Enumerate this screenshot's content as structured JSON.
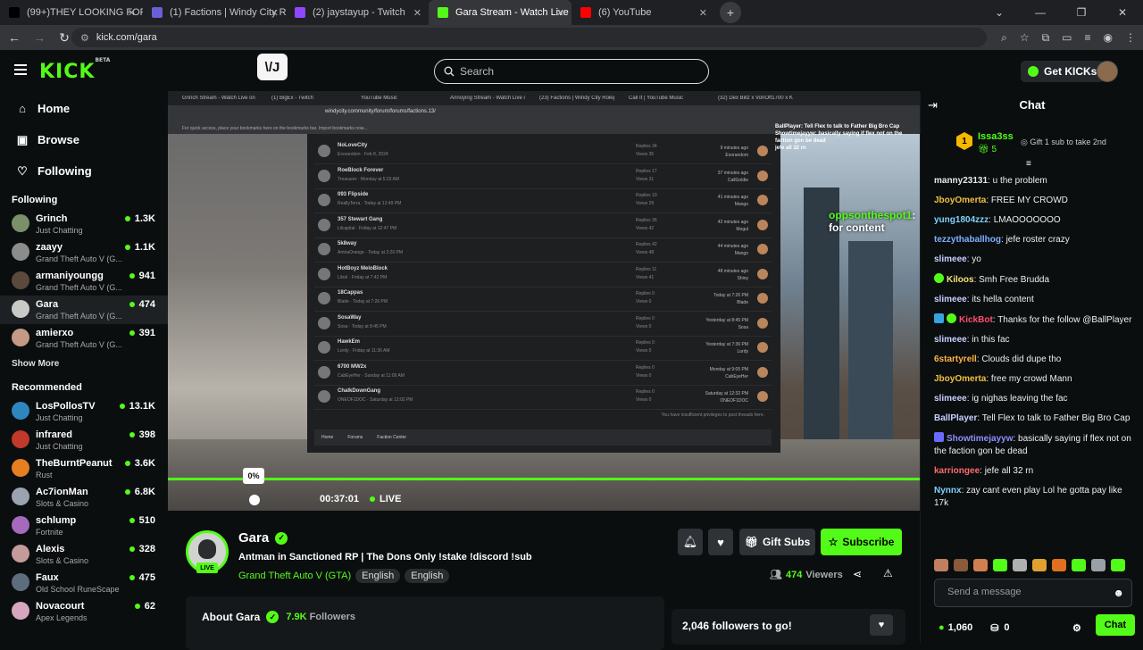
{
  "browser": {
    "tabs": [
      {
        "title": "(99+)THEY LOOKING FOR THEIR",
        "color": "#000000"
      },
      {
        "title": "(1) Factions | Windy City Rolepla",
        "color": "#6b5fd8"
      },
      {
        "title": "(2) jaystayup - Twitch",
        "color": "#9146ff"
      },
      {
        "title": "Gara Stream - Watch Live on Ki",
        "color": "#53fc18",
        "active": true
      },
      {
        "title": "(6) YouTube",
        "color": "#ff0000"
      }
    ],
    "url": "kick.com/gara"
  },
  "header": {
    "logo": "KICK",
    "logo_sup": "BETA",
    "ext_label": "\\/J",
    "search_placeholder": "Search",
    "get_kicks": "Get KICKs"
  },
  "sidebar": {
    "nav": [
      {
        "label": "Home",
        "icon": "home-icon"
      },
      {
        "label": "Browse",
        "icon": "browse-icon"
      },
      {
        "label": "Following",
        "icon": "heart-icon"
      }
    ],
    "following_title": "Following",
    "following": [
      {
        "name": "Grinch",
        "category": "Just Chatting",
        "viewers": "1.3K",
        "color": "#7a8f6a"
      },
      {
        "name": "zaayy",
        "category": "Grand Theft Auto V (G...",
        "viewers": "1.1K",
        "color": "#8c8c8c"
      },
      {
        "name": "armaniyoungg",
        "category": "Grand Theft Auto V (G...",
        "viewers": "941",
        "color": "#5b4a3b"
      },
      {
        "name": "Gara",
        "category": "Grand Theft Auto V (G...",
        "viewers": "474",
        "color": "#c8cac8"
      },
      {
        "name": "amierxo",
        "category": "Grand Theft Auto V (G...",
        "viewers": "391",
        "color": "#c49a86"
      }
    ],
    "show_more": "Show More",
    "recommended_title": "Recommended",
    "recommended": [
      {
        "name": "LosPollosTV",
        "category": "Just Chatting",
        "viewers": "13.1K",
        "color": "#2e86c1"
      },
      {
        "name": "infrared",
        "category": "Just Chatting",
        "viewers": "398",
        "color": "#c0392b"
      },
      {
        "name": "TheBurntPeanut",
        "category": "Rust",
        "viewers": "3.6K",
        "color": "#e67e22"
      },
      {
        "name": "Ac7ionMan",
        "category": "Slots & Casino",
        "viewers": "6.8K",
        "color": "#9aa3b0"
      },
      {
        "name": "schlump",
        "category": "Fortnite",
        "viewers": "510",
        "color": "#a569bd"
      },
      {
        "name": "Alexis",
        "category": "Slots & Casino",
        "viewers": "328",
        "color": "#c39b9b"
      },
      {
        "name": "Faux",
        "category": "Old School RuneScape",
        "viewers": "475",
        "color": "#5d6d7e"
      },
      {
        "name": "Novacourt",
        "category": "Apex Legends",
        "viewers": "62",
        "color": "#d5a6bd"
      }
    ]
  },
  "video": {
    "inner_url": "windycity.community/forum/forums/factions.13/",
    "inner_tabs": [
      "Grinch Stream - Watch Live on Kick",
      "(1) BigEx - Twitch",
      "YouTube Music",
      "Annoying Stream - Watch Live on Kick",
      "(23) Factions | Windy City Rolep",
      "Call It | YouTube Music",
      "(32) Dex Billz x VonOff1700 x Kyle R"
    ],
    "bookmarks_hint": "For quick access, place your bookmarks here on the bookmarks bar. Import bookmarks now...",
    "forum_rows": [
      {
        "title": "NoLoveCity",
        "sub": "Exorandom · Feb 8, 2024",
        "replies": "34",
        "views": "35",
        "date": "9 minutes ago",
        "user": "Exorandom"
      },
      {
        "title": "RoeBlock Forever",
        "sub": "Treasurer · Monday at 5:23 AM",
        "replies": "17",
        "views": "31",
        "date": "37 minutes ago",
        "user": "CallGoldie"
      },
      {
        "title": "093 Flipside",
        "sub": "ReallyTerra · Today at 12:49 PM",
        "replies": "19",
        "views": "29",
        "date": "41 minutes ago",
        "user": "Mango"
      },
      {
        "title": "357 Stewart Gang",
        "sub": "Lilcapital · Friday at 12:47 PM",
        "replies": "36",
        "views": "42",
        "date": "42 minutes ago",
        "user": "Mogul"
      },
      {
        "title": "5k8way",
        "sub": "AmiraOrange · Today at 2:26 PM",
        "replies": "42",
        "views": "48",
        "date": "44 minutes ago",
        "user": "Mango"
      },
      {
        "title": "HotBoyz MeloBlock",
        "sub": "Lilsol · Friday at 7:42 PM",
        "replies": "11",
        "views": "41",
        "date": "48 minutes ago",
        "user": "Shiny"
      },
      {
        "title": "18Cappas",
        "sub": "Blade · Today at 7:26 PM",
        "replies": "0",
        "views": "0",
        "date": "Today at 7:26 PM",
        "user": "Blade"
      },
      {
        "title": "SosaWay",
        "sub": "Sosa · Today at 8:45 PM",
        "replies": "0",
        "views": "0",
        "date": "Yesterday at 8:45 PM",
        "user": "Sosa"
      },
      {
        "title": "HawkEm",
        "sub": "Lordy · Friday at 11:36 AM",
        "replies": "0",
        "views": "0",
        "date": "Yesterday at 7:36 PM",
        "user": "Lordy"
      },
      {
        "title": "6700 MW2x",
        "sub": "CabEyeHer · Sunday at 11:09 AM",
        "replies": "0",
        "views": "0",
        "date": "Monday at 9:05 PM",
        "user": "CabEyeHer"
      },
      {
        "title": "ChalkDownGang",
        "sub": "ONEOF1DOC · Saturday at 12:02 PM",
        "replies": "0",
        "views": "0",
        "date": "Saturday at 12:32 PM",
        "user": "ONEOF1DOC"
      }
    ],
    "forum_foot": [
      "Home",
      "Forums",
      "Faction Center"
    ],
    "forum_note": "You have insufficient privileges to post threads here.",
    "overlay_chat": "BallPlayer: Tell Flex to talk to Father Big Bro Cap\nShowtimejayyw: basically saying if flex not on the faction gon be dead\njefe all 32 rn",
    "overlay_user": "oppsonthespot1",
    "overlay_msg": ": for content",
    "volume_tip": "0%",
    "volume_level": 0,
    "time": "00:37:01",
    "live": "LIVE"
  },
  "channel": {
    "name": "Gara",
    "live_badge": "LIVE",
    "title": "Antman in Sanctioned RP | The Dons Only !stake !discord !sub",
    "game": "Grand Theft Auto V (GTA)",
    "tags": [
      "English",
      "English"
    ],
    "gift_label": "Gift Subs",
    "subscribe_label": "Subscribe",
    "viewers_count": "474",
    "viewers_label": "Viewers",
    "about_title": "About Gara",
    "followers_count": "7.9K",
    "followers_label": "Followers",
    "goal_text": "2,046 followers to go!"
  },
  "chat": {
    "title": "Chat",
    "pinned": {
      "user": "Issa3ss",
      "count": "5",
      "message": "Gift 1 sub to take 2nd"
    },
    "messages": [
      {
        "user": "manny23131",
        "color": "#e8e8e8",
        "text": "u the problem",
        "badge": ""
      },
      {
        "user": "JboyOmerta",
        "color": "#f0c040",
        "text": "FREE MY CROWD",
        "badge": ""
      },
      {
        "user": "yung1804zzz",
        "color": "#7fd3ff",
        "text": "LMAOOOOOOO",
        "badge": ""
      },
      {
        "user": "tezzythaballhog",
        "color": "#7fb0ff",
        "text": "jefe roster crazy",
        "badge": ""
      },
      {
        "user": "slimeee",
        "color": "#c8d0ff",
        "text": "yo",
        "badge": ""
      },
      {
        "user": "Kiloos",
        "color": "#f5e07a",
        "text": "Smh Free Brudda",
        "badge": "verified"
      },
      {
        "user": "slimeee",
        "color": "#c8d0ff",
        "text": "its hella content",
        "badge": ""
      },
      {
        "user": "KickBot",
        "color": "#ff4d6d",
        "text": "Thanks for the follow @BallPlayer",
        "badge": "bot"
      },
      {
        "user": "slimeee",
        "color": "#c8d0ff",
        "text": "in this fac",
        "badge": ""
      },
      {
        "user": "6startyrell",
        "color": "#ffb347",
        "text": "Clouds did dupe tho",
        "badge": ""
      },
      {
        "user": "JboyOmerta",
        "color": "#f0c040",
        "text": "free my crowd Mann",
        "badge": ""
      },
      {
        "user": "slimeee",
        "color": "#c8d0ff",
        "text": "ig nighas leaving the fac",
        "badge": ""
      },
      {
        "user": "BallPlayer",
        "color": "#c8d0ff",
        "text": "Tell Flex to talk to Father Big Bro Cap",
        "badge": ""
      },
      {
        "user": "Showtimejayyw",
        "color": "#8f8fff",
        "text": "basically saying if flex not on the faction gon be dead",
        "badge": "sub"
      },
      {
        "user": "karriongee",
        "color": "#ff6b6b",
        "text": "jefe all 32 rn",
        "badge": ""
      },
      {
        "user": "Nynnx",
        "color": "#7fd3ff",
        "text": "zay cant even play Lol he gotta pay like 17k",
        "badge": ""
      }
    ],
    "input_placeholder": "Send a message",
    "kicks_balance": "1,060",
    "points": "0",
    "chat_button": "Chat"
  }
}
